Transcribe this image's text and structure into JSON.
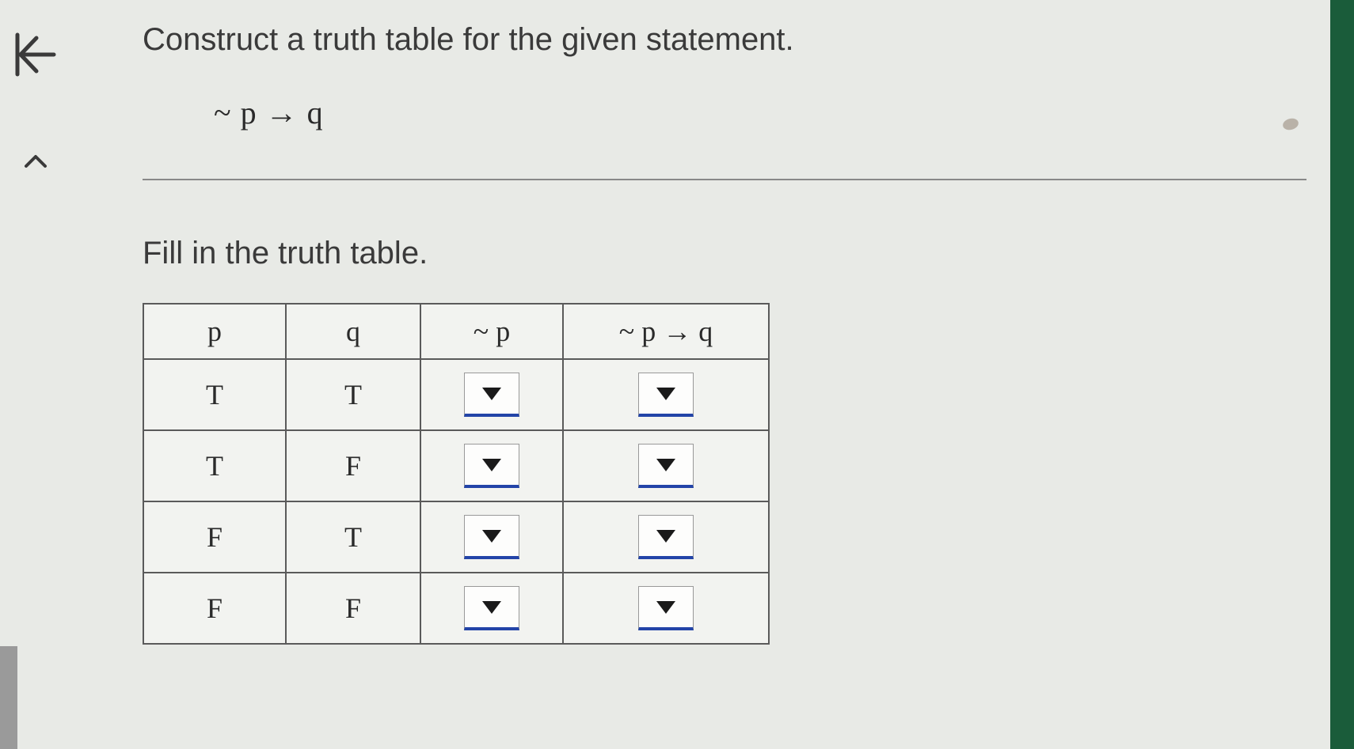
{
  "sidebar": {
    "back_label": "back",
    "collapse_label": "collapse"
  },
  "header": {
    "instruction": "Construct a truth table for the given statement.",
    "statement": "~ p → q"
  },
  "prompt": {
    "fill": "Fill in the truth table."
  },
  "table": {
    "headers": {
      "p": "p",
      "q": "q",
      "not_p": "~ p",
      "result": "~ p → q"
    },
    "rows": [
      {
        "p": "T",
        "q": "T",
        "not_p": "",
        "result": ""
      },
      {
        "p": "T",
        "q": "F",
        "not_p": "",
        "result": ""
      },
      {
        "p": "F",
        "q": "T",
        "not_p": "",
        "result": ""
      },
      {
        "p": "F",
        "q": "F",
        "not_p": "",
        "result": ""
      }
    ]
  }
}
